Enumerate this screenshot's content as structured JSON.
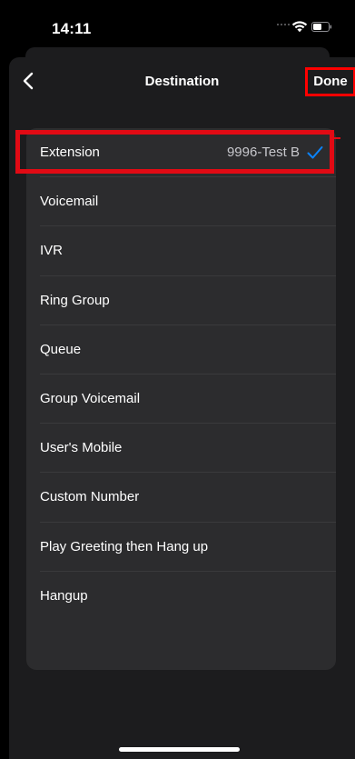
{
  "status_bar": {
    "time": "14:11"
  },
  "nav": {
    "title": "Destination",
    "done_label": "Done"
  },
  "destinations": [
    {
      "label": "Extension",
      "value": "9996-Test B",
      "selected": true
    },
    {
      "label": "Voicemail"
    },
    {
      "label": "IVR"
    },
    {
      "label": "Ring Group"
    },
    {
      "label": "Queue"
    },
    {
      "label": "Group Voicemail"
    },
    {
      "label": "User's Mobile"
    },
    {
      "label": "Custom Number"
    },
    {
      "label": "Play Greeting then Hang up"
    },
    {
      "label": "Hangup"
    }
  ],
  "colors": {
    "background": "#000000",
    "sheet": "#1c1c1e",
    "card": "#2c2c2e",
    "accent_check": "#0a84ff",
    "highlight": "#e10a14"
  },
  "icons": {
    "back": "chevron-left-icon",
    "check": "checkmark-icon",
    "wifi": "wifi-icon",
    "battery": "battery-icon"
  }
}
